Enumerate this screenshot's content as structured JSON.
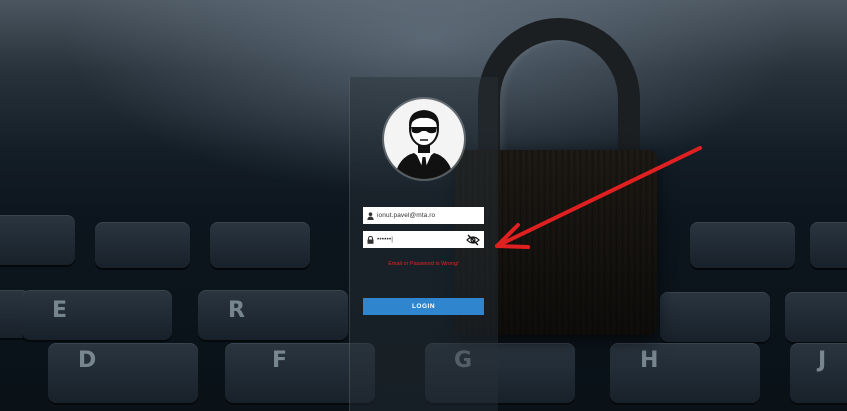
{
  "login_form": {
    "email_value": "ionut.pavel@mta.ro",
    "password_value": "••••••|",
    "error_message": "Email or Password is Wrong!",
    "login_label": "LOGIN"
  },
  "background": {
    "key_glyphs": [
      "E",
      "R",
      "D",
      "F",
      "G",
      "H",
      "J"
    ]
  },
  "colors": {
    "login_button": "#2f86cf",
    "error_text": "#e52424",
    "annotation_arrow": "#e02020"
  },
  "icons": {
    "avatar": "agent-avatar-icon",
    "email_field": "user-icon",
    "password_field": "lock-icon",
    "toggle_visibility": "eye-slash-icon"
  }
}
